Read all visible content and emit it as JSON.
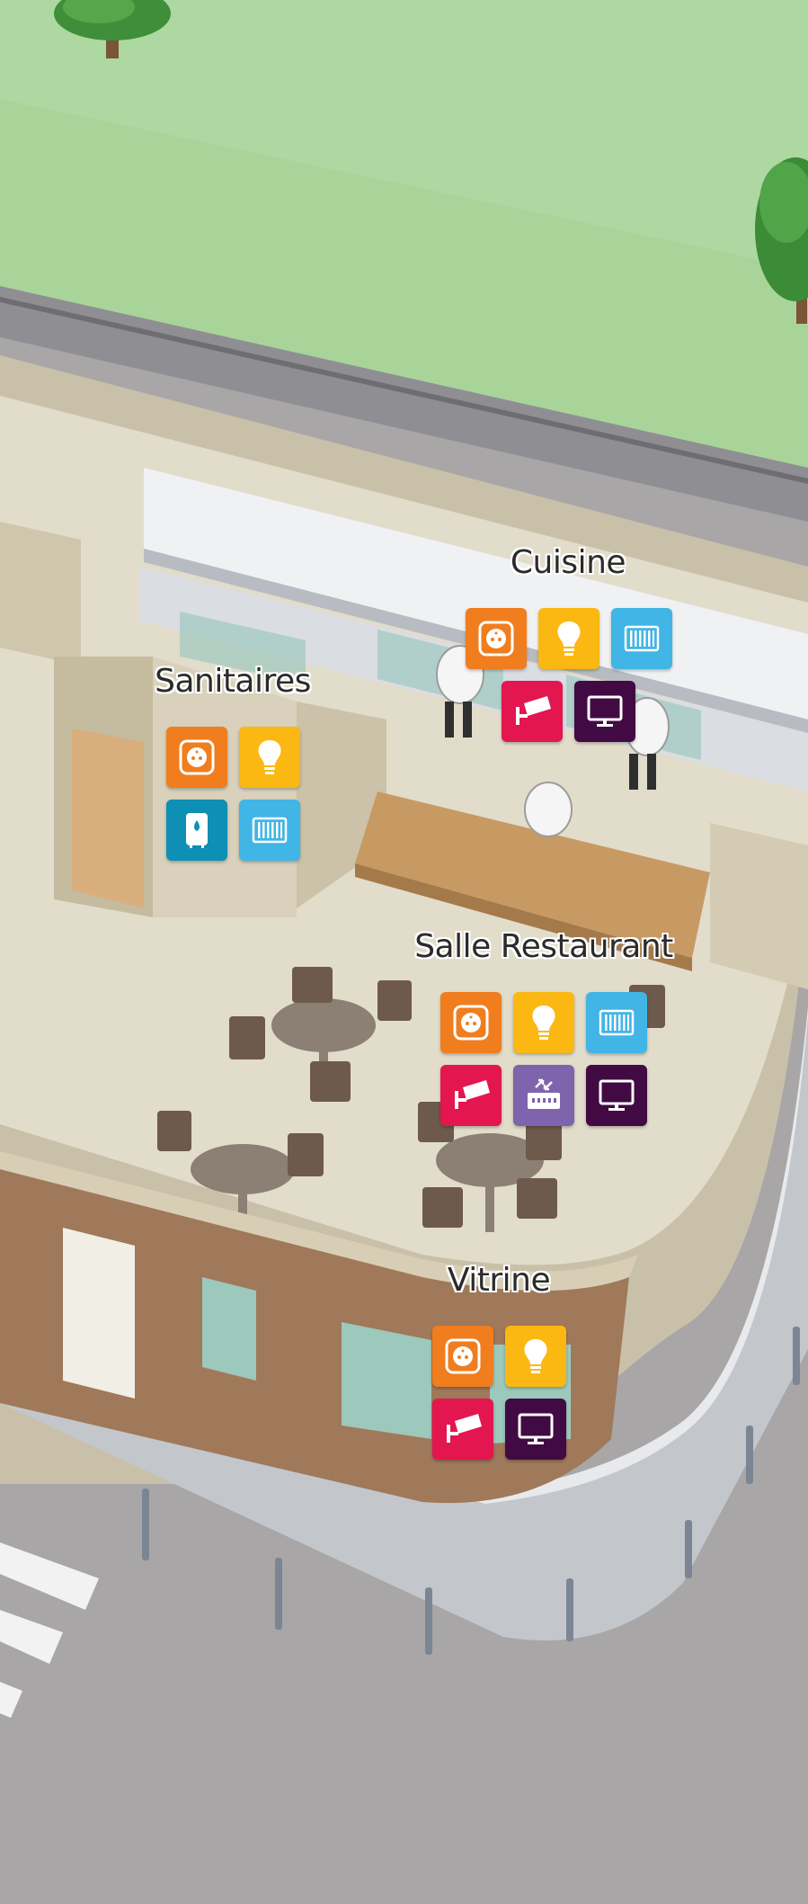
{
  "colors": {
    "outlet": "#f07d1e",
    "light": "#fbb812",
    "radiator": "#41b5e5",
    "camera": "#e3164f",
    "tv": "#420a43",
    "water_heater": "#0e8fb4",
    "network": "#7e64ad"
  },
  "zones": [
    {
      "label": "Cuisine",
      "rows": [
        [
          "outlet-icon",
          "lightbulb-icon",
          "radiator-icon"
        ],
        [
          "camera-icon",
          "tv-icon"
        ]
      ]
    },
    {
      "label": "Sanitaires",
      "rows": [
        [
          "outlet-icon",
          "lightbulb-icon"
        ],
        [
          "water-heater-icon",
          "radiator-icon"
        ]
      ]
    },
    {
      "label": "Salle Restaurant",
      "rows": [
        [
          "outlet-icon",
          "lightbulb-icon",
          "radiator-icon"
        ],
        [
          "camera-icon",
          "network-icon",
          "tv-icon"
        ]
      ]
    },
    {
      "label": "Vitrine",
      "rows": [
        [
          "outlet-icon",
          "lightbulb-icon"
        ],
        [
          "camera-icon",
          "tv-icon"
        ]
      ]
    }
  ]
}
